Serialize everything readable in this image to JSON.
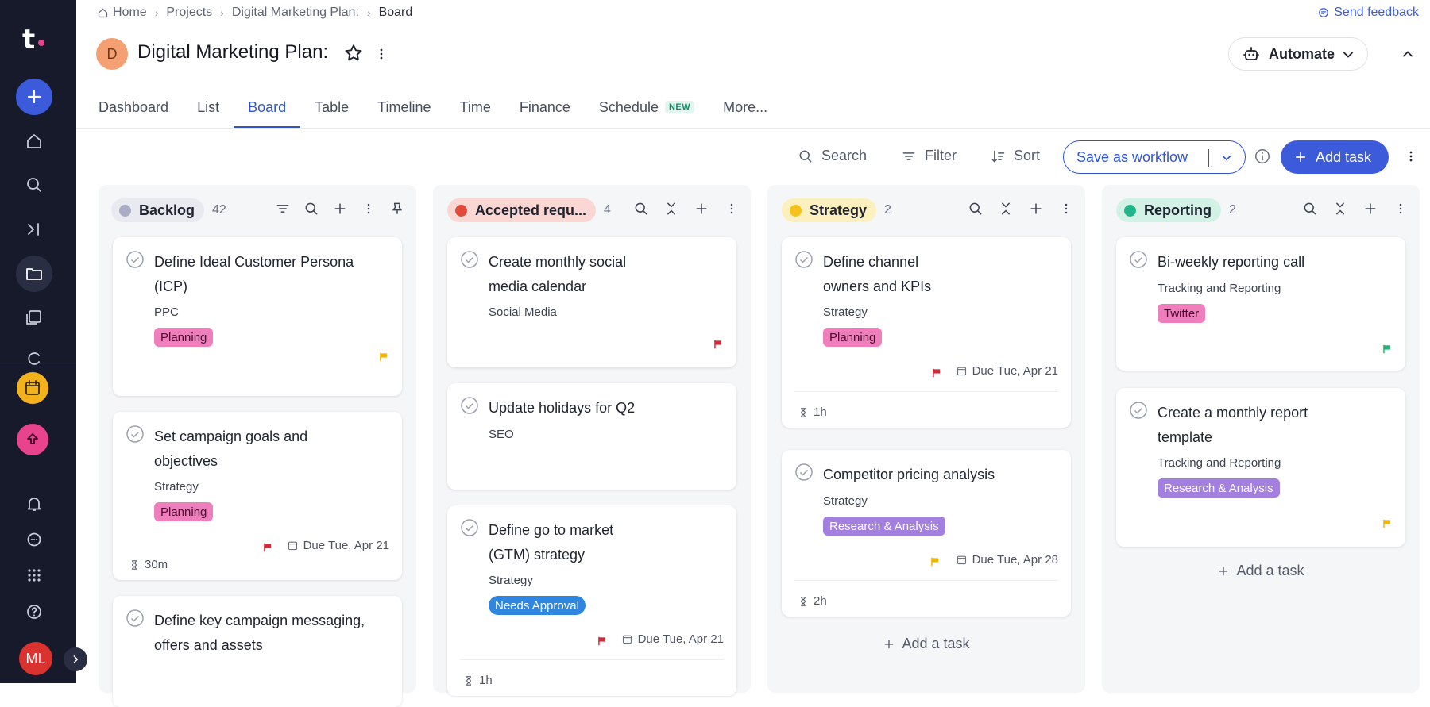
{
  "breadcrumb": {
    "home": "Home",
    "projects": "Projects",
    "plan": "Digital Marketing Plan:",
    "current": "Board"
  },
  "feedback": "Send feedback",
  "project": {
    "avatar": "D",
    "title": "Digital Marketing Plan:"
  },
  "automate": "Automate",
  "tabs": [
    {
      "label": "Dashboard"
    },
    {
      "label": "List"
    },
    {
      "label": "Board"
    },
    {
      "label": "Table"
    },
    {
      "label": "Timeline"
    },
    {
      "label": "Time"
    },
    {
      "label": "Finance"
    },
    {
      "label": "Schedule",
      "badge": "NEW"
    },
    {
      "label": "More..."
    }
  ],
  "toolbar": {
    "search": "Search",
    "filter": "Filter",
    "sort": "Sort",
    "save_workflow": "Save as workflow",
    "add_task": "Add task"
  },
  "user": {
    "initials": "ML"
  },
  "columns": [
    {
      "name": "Backlog",
      "count": "42",
      "color": "#a9acc4",
      "cards": [
        {
          "title": "Define Ideal Customer Persona (ICP)",
          "sub": "PPC",
          "tag": "Planning"
        },
        {
          "title": "Set campaign goals and objectives",
          "sub": "Strategy",
          "tag": "Planning",
          "due": "Due Tue, Apr 21",
          "time": "30m"
        },
        {
          "title": "Define key campaign messaging, offers and assets"
        }
      ]
    },
    {
      "name": "Accepted requ...",
      "count": "4",
      "color": "#e24b3b",
      "cards": [
        {
          "title": "Create monthly social media calendar",
          "sub": "Social Media"
        },
        {
          "title": "Update holidays for Q2",
          "sub": "SEO"
        },
        {
          "title": "Define go to market (GTM) strategy",
          "sub": "Strategy",
          "tag": "Needs Approval",
          "due": "Due Tue, Apr 21",
          "time": "1h"
        }
      ]
    },
    {
      "name": "Strategy",
      "count": "2",
      "color": "#f4c21b",
      "cards": [
        {
          "title": "Define channel owners and KPIs",
          "sub": "Strategy",
          "tag": "Planning",
          "due": "Due Tue, Apr 21",
          "time": "1h"
        },
        {
          "title": "Competitor pricing analysis",
          "sub": "Strategy",
          "tag": "Research & Analysis",
          "due": "Due Tue, Apr 28",
          "time": "2h"
        }
      ],
      "add": "Add a task"
    },
    {
      "name": "Reporting",
      "count": "2",
      "color": "#22b58a",
      "cards": [
        {
          "title": "Bi-weekly reporting call",
          "sub": "Tracking and Reporting",
          "tag": "Twitter"
        },
        {
          "title": "Create a monthly report template",
          "sub": "Tracking and Reporting",
          "tag": "Research & Analysis"
        }
      ],
      "add": "Add a task"
    }
  ],
  "colors": {
    "accent": "#3b5bdb",
    "rail": "#171a2b",
    "flag_red": "#d12b3a",
    "flag_yellow": "#f2b705",
    "flag_green": "#21b077"
  }
}
